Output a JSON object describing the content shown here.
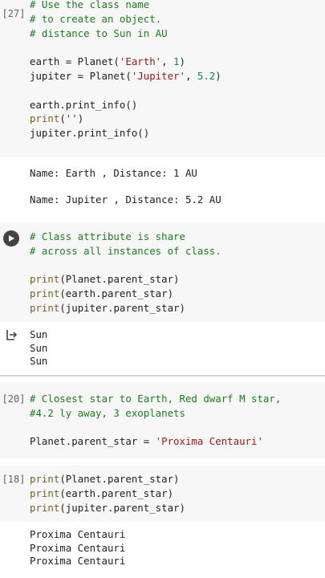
{
  "cell1": {
    "exec_count": "[27]",
    "lines": [
      {
        "parts": [
          {
            "t": "# Use the class name",
            "c": "cm"
          }
        ]
      },
      {
        "parts": [
          {
            "t": "# to create an object.",
            "c": "cm"
          }
        ]
      },
      {
        "parts": [
          {
            "t": "# distance to Sun in AU",
            "c": "cm"
          }
        ]
      },
      {
        "parts": []
      },
      {
        "parts": [
          {
            "t": "earth = Planet(",
            "c": ""
          },
          {
            "t": "'Earth'",
            "c": "str"
          },
          {
            "t": ", ",
            "c": ""
          },
          {
            "t": "1",
            "c": "num"
          },
          {
            "t": ")",
            "c": ""
          }
        ]
      },
      {
        "parts": [
          {
            "t": "jupiter = Planet(",
            "c": ""
          },
          {
            "t": "'Jupiter'",
            "c": "str"
          },
          {
            "t": ", ",
            "c": ""
          },
          {
            "t": "5.2",
            "c": "num"
          },
          {
            "t": ")",
            "c": ""
          }
        ]
      },
      {
        "parts": []
      },
      {
        "parts": [
          {
            "t": "earth.print_info()",
            "c": ""
          }
        ]
      },
      {
        "parts": [
          {
            "t": "print",
            "c": "kw"
          },
          {
            "t": "(",
            "c": ""
          },
          {
            "t": "''",
            "c": "str"
          },
          {
            "t": ")",
            "c": ""
          }
        ]
      },
      {
        "parts": [
          {
            "t": "jupiter.print_info()",
            "c": ""
          }
        ]
      }
    ],
    "output": "Name: Earth , Distance: 1 AU\n\nName: Jupiter , Distance: 5.2 AU"
  },
  "cell2": {
    "lines": [
      {
        "parts": [
          {
            "t": "# Class attribute is share",
            "c": "cm"
          }
        ]
      },
      {
        "parts": [
          {
            "t": "# across all instances of class.",
            "c": "cm"
          }
        ]
      },
      {
        "parts": []
      },
      {
        "parts": [
          {
            "t": "print",
            "c": "kw"
          },
          {
            "t": "(Planet.parent_star)",
            "c": ""
          }
        ]
      },
      {
        "parts": [
          {
            "t": "print",
            "c": "kw"
          },
          {
            "t": "(earth.parent_star)",
            "c": ""
          }
        ]
      },
      {
        "parts": [
          {
            "t": "print",
            "c": "kw"
          },
          {
            "t": "(jupiter.parent_star)",
            "c": ""
          }
        ]
      }
    ],
    "output": "Sun\nSun\nSun"
  },
  "cell3": {
    "exec_count": "[20]",
    "lines": [
      {
        "parts": [
          {
            "t": "# Closest star to Earth, Red dwarf M star,",
            "c": "cm"
          }
        ]
      },
      {
        "parts": [
          {
            "t": "#4.2 ly away, 3 exoplanets",
            "c": "cm"
          }
        ]
      },
      {
        "parts": []
      },
      {
        "parts": [
          {
            "t": "Planet.parent_star = ",
            "c": ""
          },
          {
            "t": "'Proxima Centauri'",
            "c": "str"
          }
        ]
      }
    ]
  },
  "cell4": {
    "exec_count": "[18]",
    "lines": [
      {
        "parts": [
          {
            "t": "print",
            "c": "kw"
          },
          {
            "t": "(Planet.parent_star)",
            "c": ""
          }
        ]
      },
      {
        "parts": [
          {
            "t": "print",
            "c": "kw"
          },
          {
            "t": "(earth.parent_star)",
            "c": ""
          }
        ]
      },
      {
        "parts": [
          {
            "t": "print",
            "c": "kw"
          },
          {
            "t": "(jupiter.parent_star)",
            "c": ""
          }
        ]
      }
    ],
    "output": "Proxima Centauri\nProxima Centauri\nProxima Centauri"
  }
}
